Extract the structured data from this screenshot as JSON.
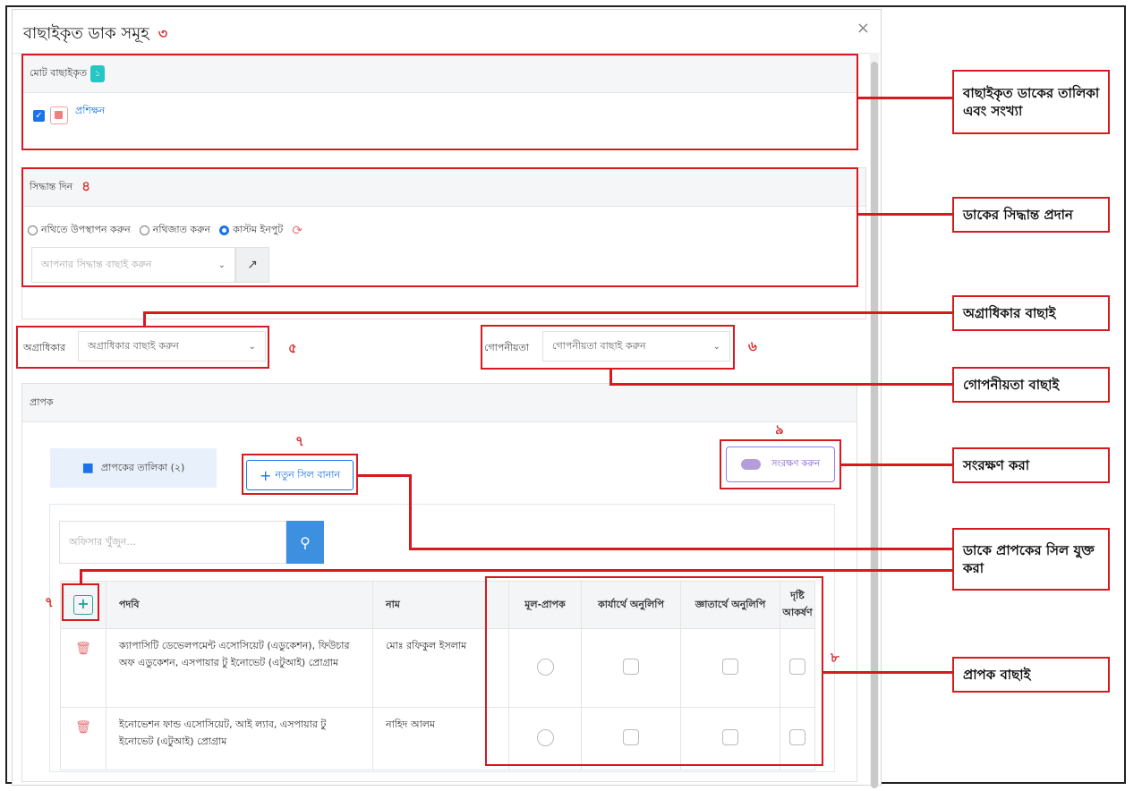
{
  "modal": {
    "title": "বাছাইকৃত ডাক সমূহ",
    "title_num": "৩",
    "close_label": "×"
  },
  "selected": {
    "header": "মোট বাছাইকৃত",
    "count": "১",
    "item_label": "প্রশিক্ষন"
  },
  "decision": {
    "header": "সিদ্ধান্ত দিন",
    "header_num": "৪",
    "radio_options": [
      "নথিতে উপস্থাপন করুন",
      "নথিজাত করুন",
      "কাস্টম ইনপুট"
    ],
    "selected_option": "কাস্টম ইনপুট",
    "select_placeholder": "আপনার সিদ্ধান্ত বাছাই করুন"
  },
  "priority": {
    "label": "অগ্রাধিকার",
    "placeholder": "অগ্রাধিকার বাছাই করুন",
    "num": "৫"
  },
  "confidentiality": {
    "label": "গোপনীয়তা",
    "placeholder": "গোপনীয়তা বাছাই করুন",
    "num": "৬"
  },
  "recipient": {
    "header": "প্রাপক",
    "list_tab": "প্রাপকের তালিকা (২)",
    "new_seal_button": "নতুন সিল বানান",
    "new_seal_num": "৭",
    "save_button": "সংরক্ষণ করুন",
    "save_num": "৯",
    "search_placeholder": "অফিসার খুঁজুন...",
    "add_num": "৭",
    "table_num": "৮",
    "columns": [
      "পদবি",
      "নাম",
      "মূল-প্রাপক",
      "কার্যার্থে অনুলিপি",
      "জ্ঞাতার্থে অনুলিপি",
      "দৃষ্টি আকর্ষণ"
    ],
    "rows": [
      {
        "designation": "ক্যাপাসিটি ডেভেলপমেন্ট এসোসিয়েট (এডুকেশন), ফিউচার অফ এডুকেশন, এসপায়ার টু ইনোভেট (এটুআই) প্রোগ্রাম",
        "name": "মোঃ রফিকুল ইসলাম"
      },
      {
        "designation": "ইনোভেশন ফান্ড এসোসিয়েট, আই ল্যাব, এসপায়ার টু ইনোভেট (এটুআই) প্রোগ্রাম",
        "name": "নাহিদ আলম"
      }
    ]
  },
  "callouts": {
    "c1": "বাছাইকৃত ডাকের তালিকা এবং সংখ্যা",
    "c2": "ডাকের সিদ্ধান্ত প্রদান",
    "c3": "অগ্রাধিকার বাছাই",
    "c4": "গোপনীয়তা বাছাই",
    "c5": "সংরক্ষণ করা",
    "c6": "ডাকে প্রাপকের সিল যুক্ত করা",
    "c7": "প্রাপক বাছাই"
  },
  "colors": {
    "annotation_red": "#d71920",
    "accent_blue": "#1a73e8",
    "badge_teal": "#26c6c6"
  }
}
